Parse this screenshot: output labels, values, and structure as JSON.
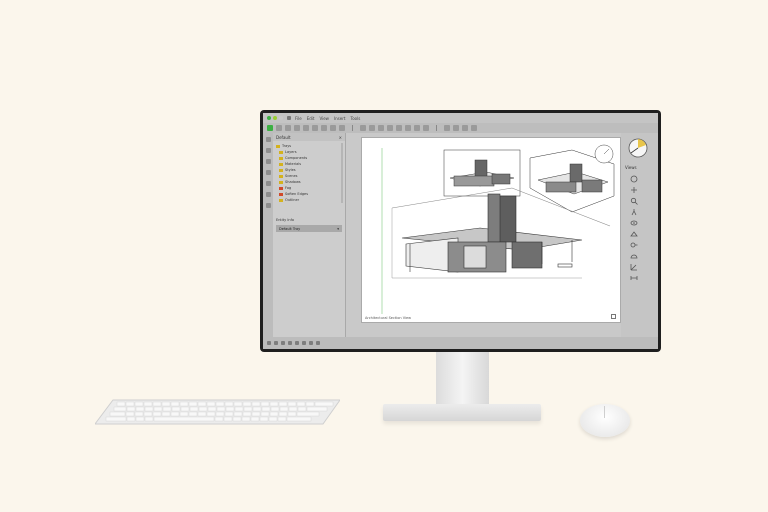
{
  "app": {
    "menu": [
      "File",
      "Edit",
      "View",
      "Insert",
      "Tools"
    ],
    "window_dots": [
      "#3cb043",
      "#9acd32",
      "#c9c9c9"
    ]
  },
  "panel": {
    "title": "Default",
    "tree": [
      {
        "label": "Trays",
        "color": "#d4b21e"
      },
      {
        "label": "Layers",
        "color": "#d4b21e"
      },
      {
        "label": "Components",
        "color": "#d4b21e"
      },
      {
        "label": "Materials",
        "color": "#d4b21e"
      },
      {
        "label": "Styles",
        "color": "#d4b21e"
      },
      {
        "label": "Scenes",
        "color": "#d4b21e"
      },
      {
        "label": "Shadows",
        "color": "#d4b21e"
      },
      {
        "label": "Fog",
        "color": "#d04a2a"
      },
      {
        "label": "Soften Edges",
        "color": "#d04a2a"
      },
      {
        "label": "Outliner",
        "color": "#d4b21e"
      }
    ],
    "section_label": "Entity Info",
    "select_value": "Default Tray"
  },
  "viewport": {
    "label": "Architectural Section View"
  },
  "right_strip": {
    "label": "Views",
    "icons": [
      "orbit-icon",
      "pan-icon",
      "zoom-icon",
      "walk-icon",
      "look-around-icon",
      "section-icon",
      "tape-icon",
      "protractor-icon",
      "axes-icon",
      "dimension-icon"
    ]
  },
  "colors": {
    "accent_green": "#3cb043",
    "compass_yellow": "#e8c54a"
  }
}
